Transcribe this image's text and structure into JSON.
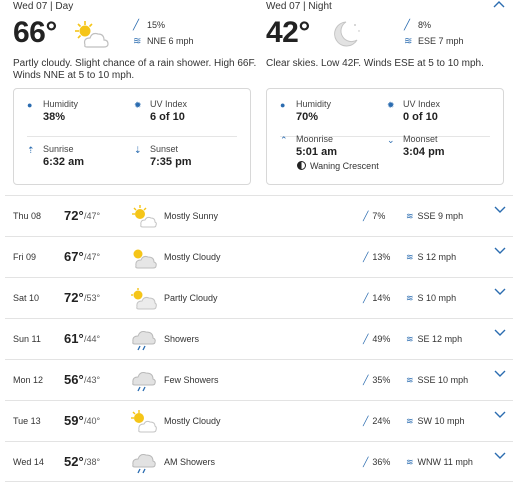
{
  "day": {
    "date": "Wed 07 | Day",
    "temp": "66°",
    "icon": "partly-sunny-icon",
    "precip": "15%",
    "wind": "NNE 6 mph",
    "description": "Partly cloudy. Slight chance of a rain shower. High 66F. Winds NNE at 5 to 10 mph.",
    "humidity_label": "Humidity",
    "humidity": "38%",
    "uv_label": "UV Index",
    "uv": "6 of 10",
    "sunrise_label": "Sunrise",
    "sunrise": "6:32 am",
    "sunset_label": "Sunset",
    "sunset": "7:35 pm"
  },
  "night": {
    "date": "Wed 07 | Night",
    "temp": "42°",
    "icon": "moon-cloud-icon",
    "precip": "8%",
    "wind": "ESE 7 mph",
    "description": "Clear skies. Low 42F. Winds ESE at 5 to 10 mph.",
    "humidity_label": "Humidity",
    "humidity": "70%",
    "uv_label": "UV Index",
    "uv": "0 of 10",
    "moonrise_label": "Moonrise",
    "moonrise": "5:01 am",
    "moonset_label": "Moonset",
    "moonset": "3:04 pm",
    "moon_phase": "Waning Crescent"
  },
  "forecast": [
    {
      "date": "Thu 08",
      "hi": "72°",
      "lo": "/47°",
      "cond": "Mostly Sunny",
      "icon": "sun-icon",
      "precip": "7%",
      "wind": "SSE 9 mph"
    },
    {
      "date": "Fri 09",
      "hi": "67°",
      "lo": "/47°",
      "cond": "Mostly Cloudy",
      "icon": "sun-cloud-icon",
      "precip": "13%",
      "wind": "S 12 mph"
    },
    {
      "date": "Sat 10",
      "hi": "72°",
      "lo": "/53°",
      "cond": "Partly Cloudy",
      "icon": "sun-cloud-icon",
      "precip": "14%",
      "wind": "S 10 mph"
    },
    {
      "date": "Sun 11",
      "hi": "61°",
      "lo": "/44°",
      "cond": "Showers",
      "icon": "rain-cloud-icon",
      "precip": "49%",
      "wind": "SE 12 mph"
    },
    {
      "date": "Mon 12",
      "hi": "56°",
      "lo": "/43°",
      "cond": "Few Showers",
      "icon": "rain-cloud-icon",
      "precip": "35%",
      "wind": "SSE 10 mph"
    },
    {
      "date": "Tue 13",
      "hi": "59°",
      "lo": "/40°",
      "cond": "Mostly Cloudy",
      "icon": "sun-cloud-icon",
      "precip": "24%",
      "wind": "SW 10 mph"
    },
    {
      "date": "Wed 14",
      "hi": "52°",
      "lo": "/38°",
      "cond": "AM Showers",
      "icon": "rain-cloud-icon",
      "precip": "36%",
      "wind": "WNW 11 mph"
    }
  ],
  "colors": {
    "accent": "#2b6cb0",
    "sun": "#f5c518",
    "cloud": "#c8c8c8"
  }
}
